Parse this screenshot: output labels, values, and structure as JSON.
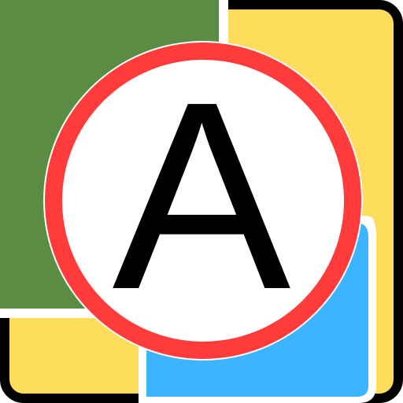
{
  "icon": {
    "name": "letter-a-map-icon",
    "letter": "A",
    "colors": {
      "outline": "#000000",
      "yellow": "#FFDD5C",
      "green": "#5A8C44",
      "blue": "#3CB4FF",
      "ring": "#FF3B3B",
      "disc": "#FFFFFF",
      "separator": "#FFFFFF",
      "letter": "#000000"
    }
  }
}
